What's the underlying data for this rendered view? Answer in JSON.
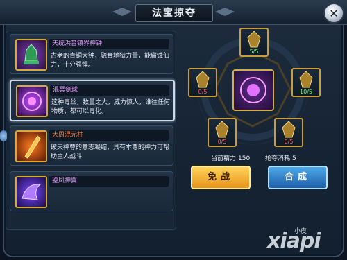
{
  "window": {
    "title": "法宝掠夺"
  },
  "treasures": [
    {
      "name": "天统洪音镇界神钟",
      "desc": "古老的青铜大钟，融合地狱力量，能腐蚀仙力，十分强悍。",
      "name_color": "#e59cff"
    },
    {
      "name": "混冥剑球",
      "desc": "这种毒丝，数量之大，威力惊人，谁往任何物质，都可以毒化。",
      "name_color": "#e59cff"
    },
    {
      "name": "大周混元柱",
      "desc": "破天神尊的意志凝缩，具有本尊的神力可帮助主人战斗",
      "name_color": "#ff7a3a"
    },
    {
      "name": "鎏凤神翼",
      "desc": "",
      "name_color": "#e59cff"
    }
  ],
  "fragments": {
    "top": "5/5",
    "upper_left": "0/5",
    "upper_right": "10/5",
    "lower_left": "0/5",
    "lower_right": "0/5"
  },
  "stats": {
    "energy_label": "当前精力:150",
    "cost_label": "抢夺消耗:5"
  },
  "buttons": {
    "free_battle": "免战",
    "combine": "合成"
  },
  "watermark": {
    "small": "小皮",
    "large": "xiapi"
  },
  "colors": {
    "gold_border": "#c99e3a",
    "count_ok": "#6cff6c",
    "count_bad": "#ff5a5a"
  }
}
